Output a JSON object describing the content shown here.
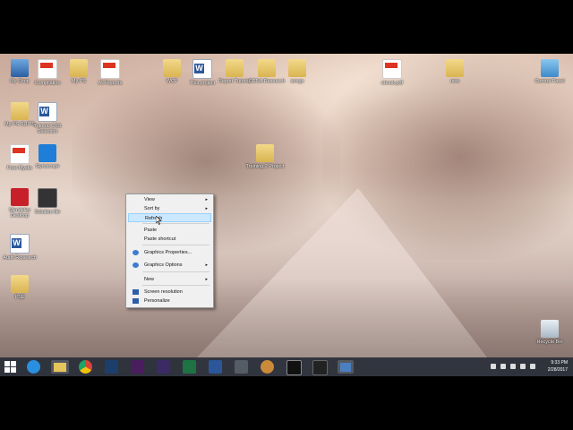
{
  "desktop": {
    "icons": [
      {
        "name": "my-shop-icon",
        "label": "My Shop",
        "type": "pc"
      },
      {
        "name": "pdf-icon-1",
        "label": "Compilation",
        "type": "pdf"
      },
      {
        "name": "folder-icon-1",
        "label": "My PS",
        "type": "folder"
      },
      {
        "name": "pdf-icon-2",
        "label": "All Reports",
        "type": "pdf"
      },
      {
        "name": "folder-icon-2",
        "label": "WCF",
        "type": "folder"
      },
      {
        "name": "word-icon-1",
        "label": "This project",
        "type": "word"
      },
      {
        "name": "folder-icon-3",
        "label": "Report Tutorial",
        "type": "folder"
      },
      {
        "name": "folder-icon-4",
        "label": "CCNA Research",
        "type": "folder"
      },
      {
        "name": "folder-icon-5",
        "label": "songs",
        "type": "folder"
      },
      {
        "name": "pdf-icon-3",
        "label": "ebook.pdf",
        "type": "pdf"
      },
      {
        "name": "folder-icon-6",
        "label": "new",
        "type": "folder"
      },
      {
        "name": "control-panel-icon",
        "label": "Control Panel",
        "type": "cp"
      },
      {
        "name": "folder-icon-7",
        "label": "My PS SUITS",
        "type": "folder"
      },
      {
        "name": "word-icon-2",
        "label": "Tutorial CSS Selection",
        "type": "word"
      },
      {
        "name": "pdf-icon-4",
        "label": "Free Mystic",
        "type": "pdf"
      },
      {
        "name": "app-icon-1",
        "label": "Gyroscope",
        "type": "blue"
      },
      {
        "name": "folder-icon-8",
        "label": "Training 2 Project",
        "type": "folder"
      },
      {
        "name": "app-icon-2",
        "label": "Mendeley Desktop",
        "type": "red"
      },
      {
        "name": "app-icon-3",
        "label": "Solution file",
        "type": "dark"
      },
      {
        "name": "word-icon-3",
        "label": "Audit Research",
        "type": "word"
      },
      {
        "name": "folder-icon-9",
        "label": "PSE",
        "type": "folder"
      },
      {
        "name": "recycle-bin-icon",
        "label": "Recycle Bin",
        "type": "bin"
      }
    ]
  },
  "context_menu": {
    "items": [
      {
        "label": "View",
        "submenu": true
      },
      {
        "label": "Sort by",
        "submenu": true
      },
      {
        "label": "Refresh",
        "submenu": false,
        "highlighted": true
      },
      {
        "label": "Paste",
        "submenu": false
      },
      {
        "label": "Paste shortcut",
        "submenu": false
      },
      {
        "label": "Graphics Properties...",
        "submenu": false,
        "icon": "intel-icon"
      },
      {
        "label": "Graphics Options",
        "submenu": true,
        "icon": "intel-icon"
      },
      {
        "label": "New",
        "submenu": true
      },
      {
        "label": "Screen resolution",
        "submenu": false,
        "icon": "monitor-icon"
      },
      {
        "label": "Personalize",
        "submenu": false,
        "icon": "monitor-icon"
      }
    ],
    "arrow": "▸"
  },
  "taskbar": {
    "pinned": [
      {
        "name": "ie-icon",
        "color": "#2a8fe0"
      },
      {
        "name": "file-explorer-icon",
        "color": "#e6c45c"
      },
      {
        "name": "chrome-icon",
        "color": "#d9443a"
      },
      {
        "name": "photoshop-icon",
        "color": "#1c3e6b"
      },
      {
        "name": "premiere-icon",
        "color": "#4a1d5e"
      },
      {
        "name": "after-effects-icon",
        "color": "#3b2a63"
      },
      {
        "name": "excel-icon",
        "color": "#1f7244"
      },
      {
        "name": "word-taskbar-icon",
        "color": "#2b579a"
      },
      {
        "name": "calculator-icon",
        "color": "#555c66"
      },
      {
        "name": "paint-icon",
        "color": "#c98a3a"
      },
      {
        "name": "cmd-icon",
        "color": "#111111"
      },
      {
        "name": "app-taskbar-icon",
        "color": "#222222"
      },
      {
        "name": "app-taskbar-icon-2",
        "color": "#4a7fc0"
      }
    ],
    "time": "9:33 PM",
    "date": "2/28/2017"
  }
}
